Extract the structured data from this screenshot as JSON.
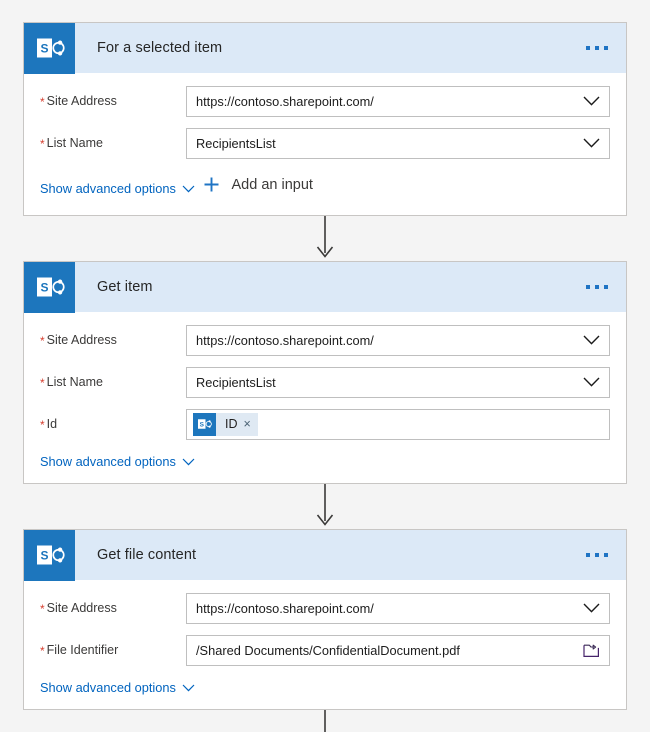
{
  "app": {
    "title": "Power Automate flow designer",
    "background_color": "#f4f4f4",
    "accent_color": "#1d76bd",
    "link_color": "#0264bf",
    "required_color": "#d64031",
    "header_band_color": "#dce9f7"
  },
  "cards": [
    {
      "title": "For a selected item",
      "icon": "sharepoint-icon",
      "menu": "more-options-icon",
      "fields": [
        {
          "label": "Site Address",
          "required": true,
          "required_marker": "*",
          "value": "https://contoso.sharepoint.com/",
          "control": "dropdown"
        },
        {
          "label": "List Name",
          "required": true,
          "required_marker": "*",
          "value": "RecipientsList",
          "control": "dropdown"
        }
      ],
      "advanced_link": "Show advanced options",
      "add_input_label": "Add an input"
    },
    {
      "title": "Get item",
      "icon": "sharepoint-icon",
      "menu": "more-options-icon",
      "fields": [
        {
          "label": "Site Address",
          "required": true,
          "required_marker": "*",
          "value": "https://contoso.sharepoint.com/",
          "control": "dropdown"
        },
        {
          "label": "List Name",
          "required": true,
          "required_marker": "*",
          "value": "RecipientsList",
          "control": "dropdown"
        },
        {
          "label": "Id",
          "required": true,
          "required_marker": "*",
          "value": "",
          "control": "token",
          "token": {
            "label": "ID",
            "icon": "sharepoint-icon",
            "remove": "×"
          }
        }
      ],
      "advanced_link": "Show advanced options"
    },
    {
      "title": "Get file content",
      "icon": "sharepoint-icon",
      "menu": "more-options-icon",
      "fields": [
        {
          "label": "Site Address",
          "required": true,
          "required_marker": "*",
          "value": "https://contoso.sharepoint.com/",
          "control": "dropdown"
        },
        {
          "label": "File Identifier",
          "required": true,
          "required_marker": "*",
          "value": "/Shared Documents/ConfidentialDocument.pdf",
          "control": "file-picker"
        }
      ],
      "advanced_link": "Show advanced options"
    }
  ],
  "connectors": [
    {
      "name": "connector-arrow-1",
      "icon": "arrow-down-icon"
    },
    {
      "name": "connector-arrow-2",
      "icon": "arrow-down-icon"
    },
    {
      "name": "connector-line-3",
      "icon": "vertical-line"
    }
  ]
}
